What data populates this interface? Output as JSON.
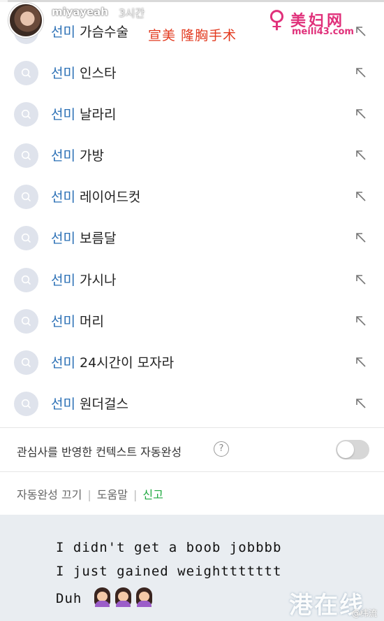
{
  "story": {
    "username": "miyayeah",
    "time": "3시간",
    "progress_fraction": 0.02
  },
  "watermarks": {
    "top_caption": "宣美 隆胸手术",
    "logo_name": "美妇网",
    "logo_url": "meili43.com",
    "bottom": "港在线",
    "weibo": "@纬流"
  },
  "suggestions": [
    {
      "keyword": "선미",
      "rest": " 가슴수술"
    },
    {
      "keyword": "선미",
      "rest": " 인스타"
    },
    {
      "keyword": "선미",
      "rest": " 날라리"
    },
    {
      "keyword": "선미",
      "rest": " 가방"
    },
    {
      "keyword": "선미",
      "rest": " 레이어드컷"
    },
    {
      "keyword": "선미",
      "rest": " 보름달"
    },
    {
      "keyword": "선미",
      "rest": " 가시나"
    },
    {
      "keyword": "선미",
      "rest": " 머리"
    },
    {
      "keyword": "선미",
      "rest": " 24시간이 모자라"
    },
    {
      "keyword": "선미",
      "rest": " 원더걸스"
    }
  ],
  "context_setting": {
    "label": "관심사를 반영한 컨텍스트 자동완성",
    "help_symbol": "?",
    "enabled": false
  },
  "footer": {
    "autocomplete_off": "자동완성 끄기",
    "help": "도움말",
    "report": "신고",
    "separator": "|"
  },
  "caption": {
    "line1": "I didn't get a boob jobbbb",
    "line2": "I just gained weighttttttt",
    "line3": "Duh"
  },
  "colors": {
    "keyword": "#2a6fb5",
    "report_link": "#1ea83f",
    "caption_bg": "#e9edf1",
    "watermark_red": "#e23a1f",
    "logo_pink": "#e0307a"
  },
  "icons": {
    "search": "search-icon",
    "insert_arrow": "arrow-up-left-icon",
    "help": "question-circle-icon",
    "emoji": "woman-emoji-icon"
  }
}
